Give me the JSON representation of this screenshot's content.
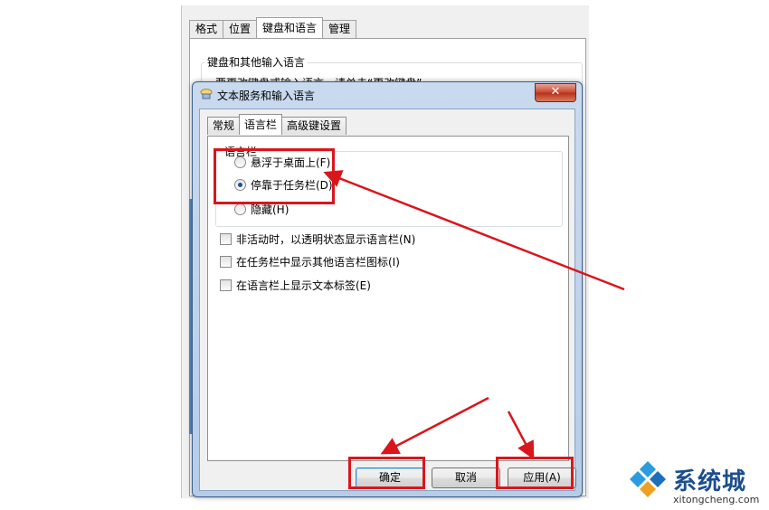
{
  "background_window": {
    "tabs": [
      "格式",
      "位置",
      "键盘和语言",
      "管理"
    ],
    "active_tab": 2,
    "group_title": "键盘和其他输入语言",
    "group_text": "要更改键盘或输入语言，请单击“更改键盘”"
  },
  "dialog": {
    "title": "文本服务和输入语言",
    "close_label": "✕",
    "tabs": [
      "常规",
      "语言栏",
      "高级键设置"
    ],
    "active_tab": 1,
    "language_bar": {
      "group_title": "语言栏",
      "options": [
        {
          "label": "悬浮于桌面上(F)",
          "checked": false
        },
        {
          "label": "停靠于任务栏(D)",
          "checked": true
        },
        {
          "label": "隐藏(H)",
          "checked": false
        }
      ]
    },
    "checkboxes": [
      {
        "label": "非活动时，以透明状态显示语言栏(N)",
        "checked": false
      },
      {
        "label": "在任务栏中显示其他语言栏图标(I)",
        "checked": false
      },
      {
        "label": "在语言栏上显示文本标签(E)",
        "checked": false
      }
    ],
    "buttons": {
      "ok": "确定",
      "cancel": "取消",
      "apply": "应用(A)"
    }
  },
  "colors": {
    "annotation_red": "#d9161c",
    "titlebar": "#c9daef",
    "logo_blue": "#1c4f8c"
  },
  "watermark": {
    "brand": "系统城",
    "url": "xitongcheng.com"
  }
}
